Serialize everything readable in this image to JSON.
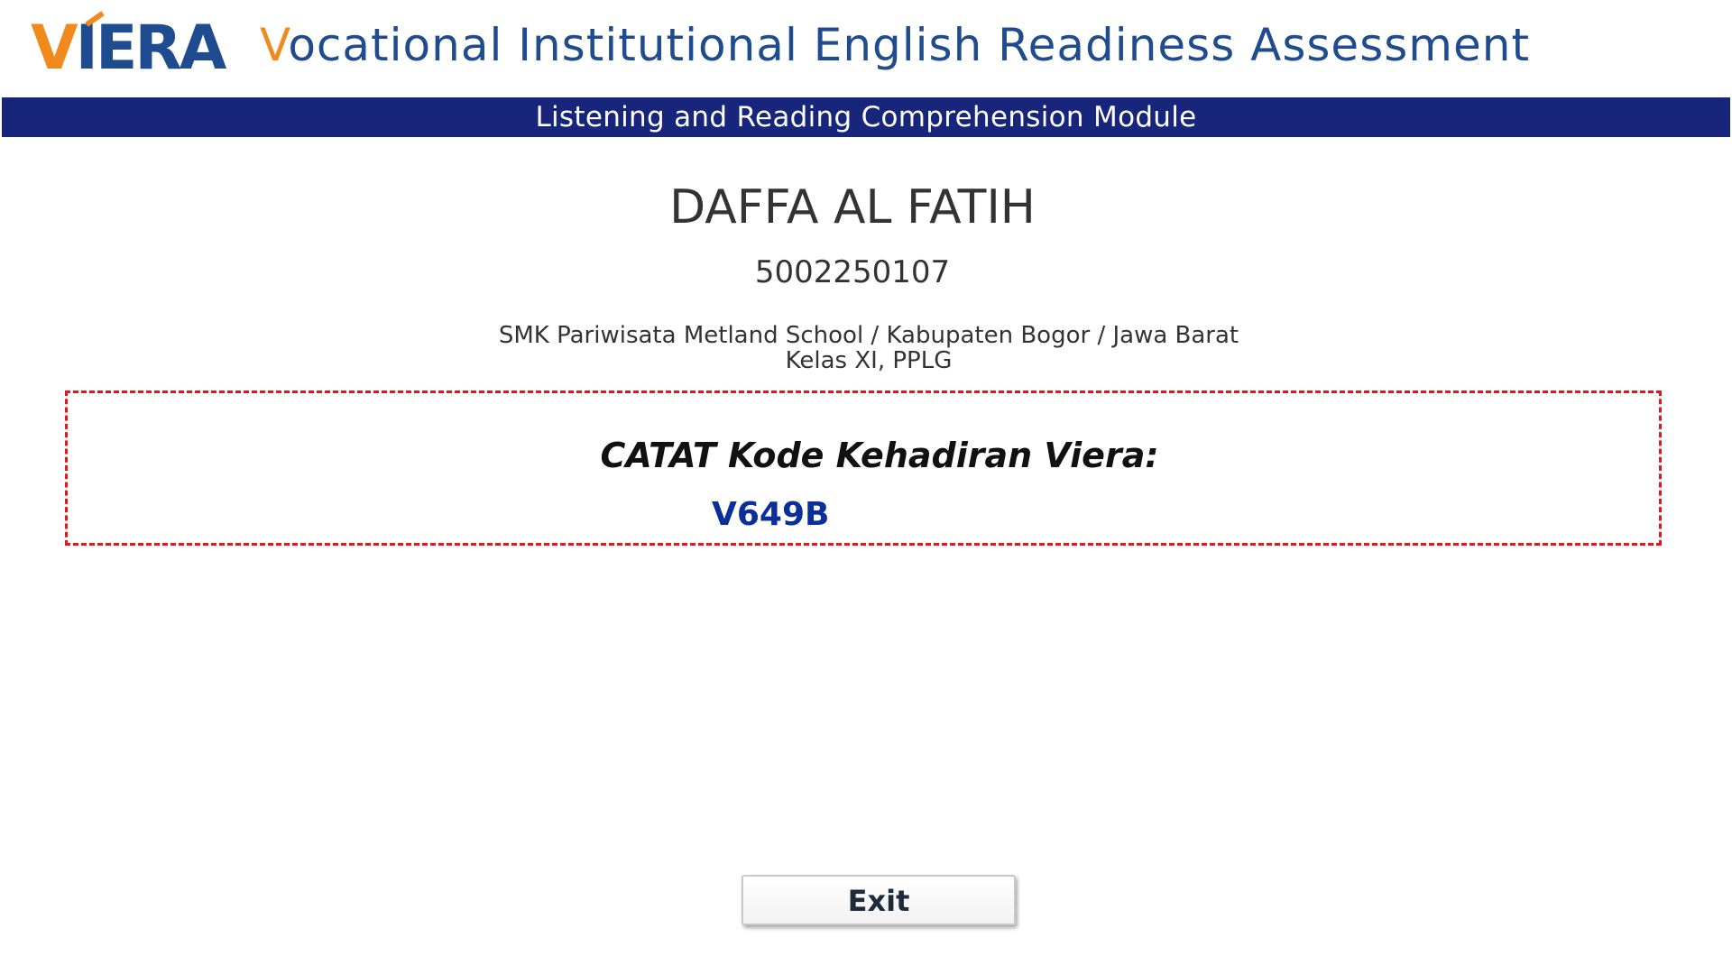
{
  "header": {
    "logo_text": "VIERA",
    "title_first_letter": "V",
    "title_rest": "ocational Institutional English Readiness Assessment",
    "module_title": "Listening and Reading Comprehension Module"
  },
  "student": {
    "name": "DAFFA AL FATIH",
    "id": "5002250107",
    "school": "SMK Pariwisata Metland School / Kabupaten Bogor / Jawa Barat",
    "class": "Kelas XI, PPLG"
  },
  "attendance": {
    "label": "CATAT Kode Kehadiran Viera:",
    "code": "V649B"
  },
  "actions": {
    "exit_label": "Exit"
  },
  "colors": {
    "brand_blue": "#1f4b8f",
    "brand_orange": "#f08a1c",
    "module_bar": "#17257a",
    "dashed_border": "#e8141c",
    "code_text": "#0b2f9a"
  }
}
